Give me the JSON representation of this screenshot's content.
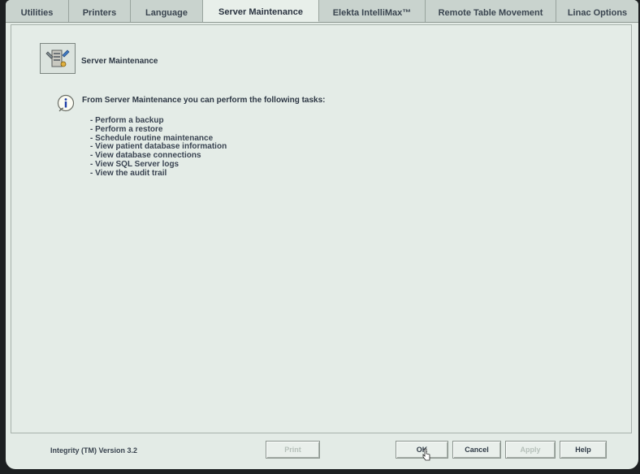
{
  "tabs": [
    {
      "label": "Utilities",
      "active": false
    },
    {
      "label": "Printers",
      "active": false
    },
    {
      "label": "Language",
      "active": false
    },
    {
      "label": "Server Maintenance",
      "active": true
    },
    {
      "label": "Elekta IntelliMax™",
      "active": false
    },
    {
      "label": "Remote Table Movement",
      "active": false
    },
    {
      "label": "Linac Options",
      "active": false
    }
  ],
  "header": {
    "title": "Server Maintenance",
    "icon": "server-maintenance-icon"
  },
  "info": {
    "icon": "info-icon",
    "intro": "From Server Maintenance you can perform the following tasks:",
    "tasks": [
      "- Perform a backup",
      "- Perform a restore",
      "- Schedule routine maintenance",
      "- View patient database information",
      "- View database connections",
      "- View SQL Server logs",
      "- View the audit trail"
    ]
  },
  "footer": {
    "version": "Integrity (TM) Version 3.2",
    "buttons": {
      "print": "Print",
      "ok": "OK",
      "cancel": "Cancel",
      "apply": "Apply",
      "help": "Help"
    }
  },
  "colors": {
    "background": "#e3ebe6",
    "tab_bar": "#c9d3ce",
    "text": "#2d3744"
  }
}
